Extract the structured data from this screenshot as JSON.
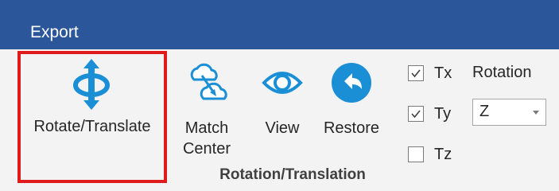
{
  "ribbon_tab": "Export",
  "buttons": {
    "rotate_translate": "Rotate/Translate",
    "match_center_line1": "Match",
    "match_center_line2": "Center",
    "view": "View",
    "restore": "Restore"
  },
  "group_label": "Rotation/Translation",
  "axis_checks": [
    {
      "label": "Tx",
      "checked": true
    },
    {
      "label": "Ty",
      "checked": true
    },
    {
      "label": "Tz",
      "checked": false
    }
  ],
  "rotation": {
    "label": "Rotation",
    "selected": "Z"
  },
  "colors": {
    "title_bar": "#2b579a",
    "icon_blue": "#1a8fd6",
    "highlight": "#e01b1b"
  }
}
